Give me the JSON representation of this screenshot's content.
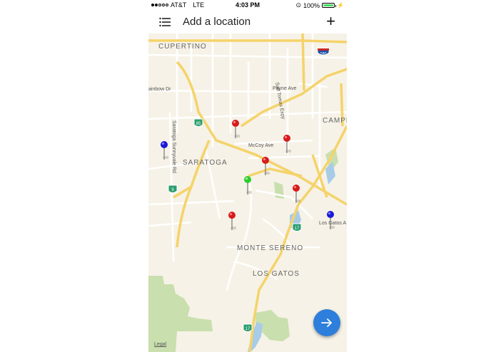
{
  "status": {
    "carrier": "AT&T",
    "network": "LTE",
    "time": "4:03 PM",
    "battery": "100%",
    "battery_level": 1.0
  },
  "nav": {
    "title": "Add a location",
    "list_icon": "list-icon",
    "add_icon": "plus-icon"
  },
  "map": {
    "places": {
      "cupertino": "CUPERTINO",
      "saratoga": "SARATOGA",
      "monte_sereno": "MONTE SERENO",
      "los_gatos": "LOS GATOS",
      "campbell": "CAMPE"
    },
    "streets": {
      "rainbow": "ainbow Dr",
      "payne": "Payne Ave",
      "mccoy": "McCoy Ave",
      "san_tomas": "San Tomas Expy",
      "saratoga_sunnyvale": "Saratoga Sunnyvale Rd",
      "los_gatos_a": "Los Gatos A"
    },
    "shields": {
      "i280": "280",
      "ca85": "85",
      "ca9": "9",
      "ca17a": "17",
      "ca17b": "17"
    },
    "legal": "Legal",
    "pin_colors": {
      "red": "#d81b1b",
      "blue": "#1a1ad6",
      "green": "#2ecc2e"
    }
  },
  "fab": {
    "icon": "arrow-right-icon"
  }
}
